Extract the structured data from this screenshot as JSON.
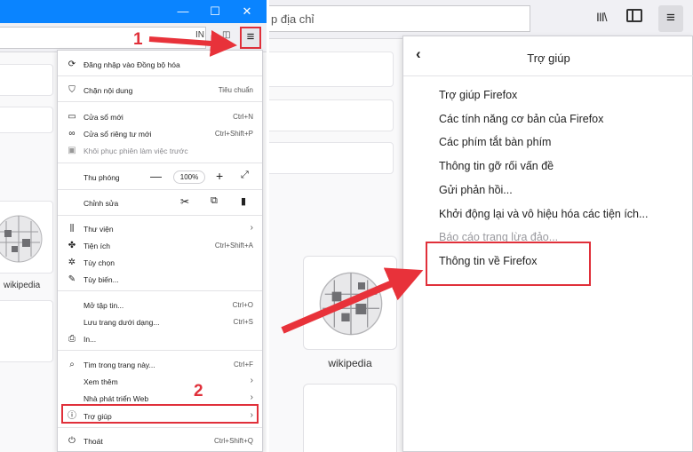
{
  "left": {
    "window_controls": {
      "minimize": "—",
      "maximize": "☐",
      "close": "✕"
    },
    "toolbar": {
      "library_mini": "IN",
      "hamburger": "≡"
    },
    "wiki_caption": "wikipedia",
    "menu": {
      "sync": {
        "icon": "sync-icon",
        "label": "Đăng nhập vào Đồng bộ hóa"
      },
      "block": {
        "icon": "shield-icon",
        "label": "Chặn nội dung",
        "value": "Tiêu chuẩn"
      },
      "new_window": {
        "icon": "window-icon",
        "label": "Cửa sổ mới",
        "shortcut": "Ctrl+N"
      },
      "private_window": {
        "icon": "mask-icon",
        "label": "Cửa sổ riêng tư mới",
        "shortcut": "Ctrl+Shift+P"
      },
      "restore": {
        "icon": "restore-icon",
        "label": "Khôi phục phiên làm việc trước"
      },
      "zoom": {
        "label": "Thu phóng",
        "minus": "—",
        "value": "100%",
        "plus": "+",
        "fullscreen": "⤢"
      },
      "edit": {
        "label": "Chỉnh sửa",
        "cut": "✂",
        "copy": "⧉",
        "paste": "📋"
      },
      "library": {
        "icon": "library-icon",
        "label": "Thư viện"
      },
      "addons": {
        "icon": "puzzle-icon",
        "label": "Tiện ích",
        "shortcut": "Ctrl+Shift+A"
      },
      "options": {
        "icon": "gear-icon",
        "label": "Tùy chọn"
      },
      "customize": {
        "icon": "brush-icon",
        "label": "Tùy biến..."
      },
      "open_file": {
        "label": "Mở tập tin...",
        "shortcut": "Ctrl+O"
      },
      "save_page": {
        "label": "Lưu trang dưới dạng...",
        "shortcut": "Ctrl+S"
      },
      "print": {
        "icon": "printer-icon",
        "label": "In..."
      },
      "find": {
        "icon": "search-icon",
        "label": "Tìm trong trang này...",
        "shortcut": "Ctrl+F"
      },
      "more": {
        "label": "Xem thêm"
      },
      "web_dev": {
        "label": "Nhà phát triển Web"
      },
      "help": {
        "icon": "help-icon",
        "label": "Trợ giúp"
      },
      "quit": {
        "icon": "power-icon",
        "label": "Thoát",
        "shortcut": "Ctrl+Shift+Q"
      },
      "arrow": "›"
    },
    "step1": "1",
    "step2": "2"
  },
  "right": {
    "url_placeholder": "p địa chỉ",
    "hamburger": "≡",
    "library": "III\\",
    "help_panel": {
      "back": "‹",
      "title": "Trợ giúp",
      "items": [
        "Trợ giúp Firefox",
        "Các tính năng cơ bản của Firefox",
        "Các phím tắt bàn phím",
        "Thông tin gỡ rối vấn đề",
        "Gửi phản hồi...",
        "Khởi động lại và vô hiệu hóa các tiện ích...",
        "Báo cáo trang lừa đảo...",
        "Thông tin về Firefox"
      ]
    },
    "wiki_caption": "wikipedia"
  },
  "colors": {
    "highlight": "#e0303a",
    "titlebar": "#0a84ff"
  }
}
